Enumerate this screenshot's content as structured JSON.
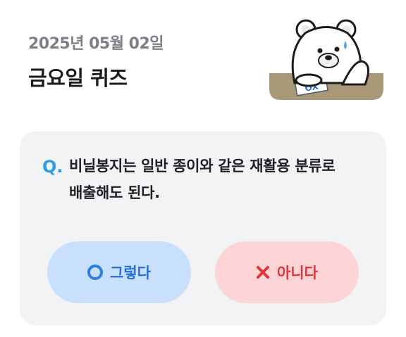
{
  "header": {
    "date": "2025년 05월 02일",
    "title": "금요일 퀴즈"
  },
  "mascot": {
    "icon": "bear-mascot-icon",
    "paper_text": "OX"
  },
  "quiz": {
    "q_label": "Q.",
    "question_line1": "비닐봉지는 일반 종이와 같은 재활용 분류로",
    "question_line2": "배출해도 된다."
  },
  "answers": {
    "yes_label": "그렇다",
    "yes_icon": "circle-o-icon",
    "no_label": "아니다",
    "no_icon": "x-mark-icon"
  },
  "colors": {
    "accent_blue": "#2f9ee0",
    "yes_bg": "#c8e0fc",
    "no_bg": "#fdd5d7",
    "no_red": "#e0363c"
  }
}
